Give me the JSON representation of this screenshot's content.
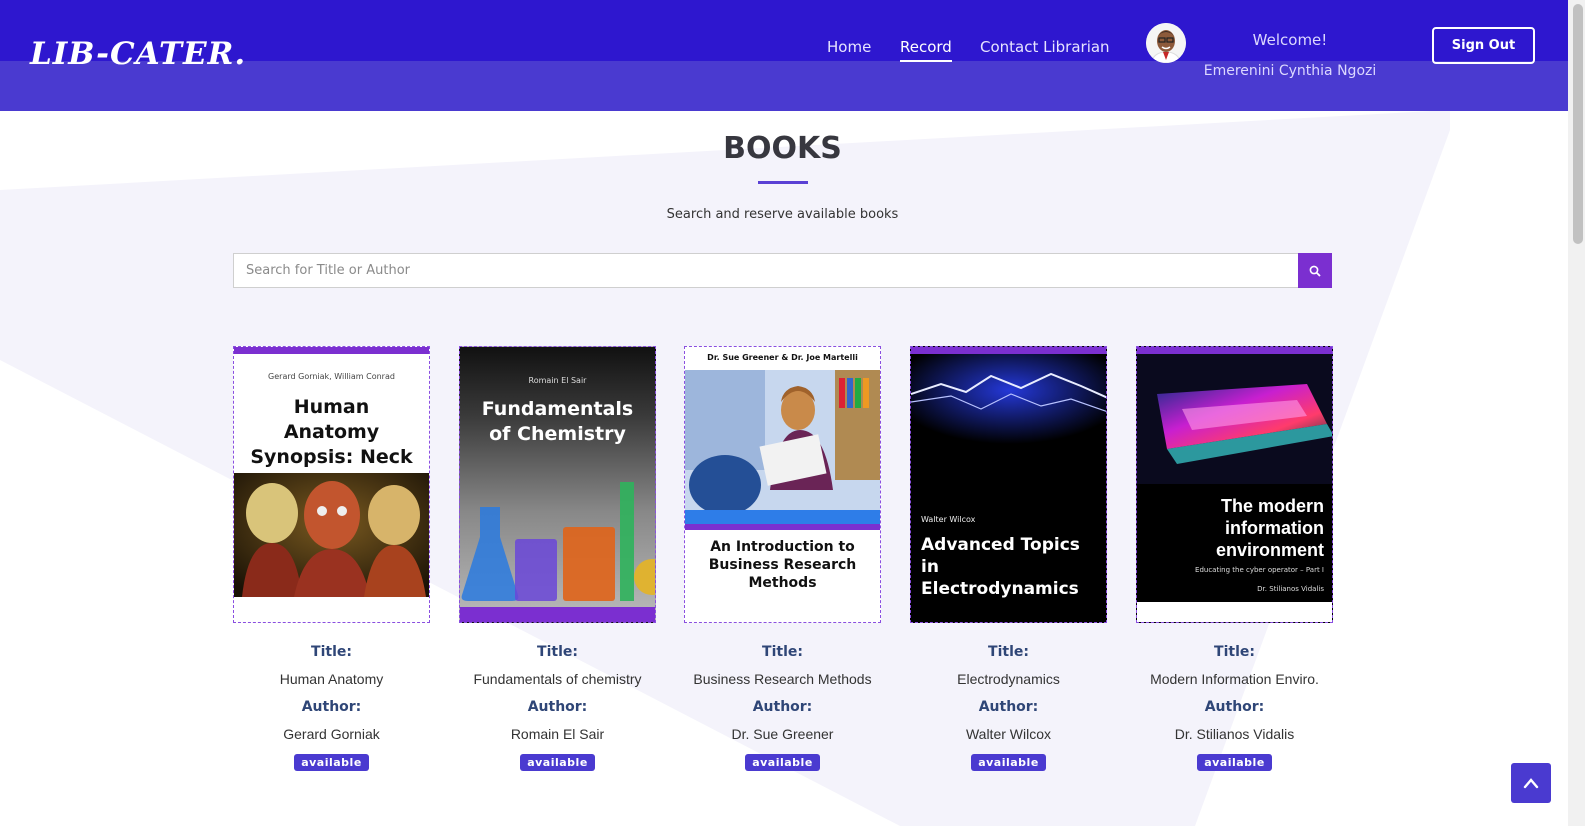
{
  "header": {
    "logo": "LIB-CATER.",
    "nav": [
      {
        "label": "Home",
        "active": false
      },
      {
        "label": "Record",
        "active": true
      },
      {
        "label": "Contact Librarian",
        "active": false
      }
    ],
    "welcome": "Welcome!",
    "user_name": "Emerenini Cynthia Ngozi",
    "signout_label": "Sign Out"
  },
  "main": {
    "title": "BOOKS",
    "subtitle": "Search and reserve available books",
    "search_placeholder": "Search for Title or Author"
  },
  "labels": {
    "title": "Title:",
    "author": "Author:"
  },
  "books": [
    {
      "title": "Human Anatomy",
      "author": "Gerard Gorniak",
      "status": "available",
      "cover_authors": "Gerard Gorniak, William Conrad",
      "cover_title": "Human Anatomy Synopsis: Neck and Head"
    },
    {
      "title": "Fundamentals of chemistry",
      "author": "Romain El Sair",
      "status": "available",
      "cover_authors": "Romain El Sair",
      "cover_title": "Fundamentals of Chemistry"
    },
    {
      "title": "Business Research Methods",
      "author": "Dr. Sue Greener",
      "status": "available",
      "cover_authors": "Dr. Sue Greener & Dr. Joe Martelli",
      "cover_title": "An Introduction to Business Research Methods"
    },
    {
      "title": "Electrodynamics",
      "author": "Walter Wilcox",
      "status": "available",
      "cover_authors": "Walter Wilcox",
      "cover_title": "Advanced Topics in Electrodynamics"
    },
    {
      "title": "Modern Information Enviro.",
      "author": "Dr. Stilianos Vidalis",
      "status": "available",
      "cover_authors": "Dr. Stilianos Vidalis",
      "cover_title": "The modern information environment",
      "cover_subtitle": "Educating the cyber operator – Part I"
    }
  ],
  "colors": {
    "header_top": "#2e17cf",
    "header_bottom": "#4a3ad0",
    "accent": "#7b2fd0",
    "badge": "#4a3ad0"
  }
}
